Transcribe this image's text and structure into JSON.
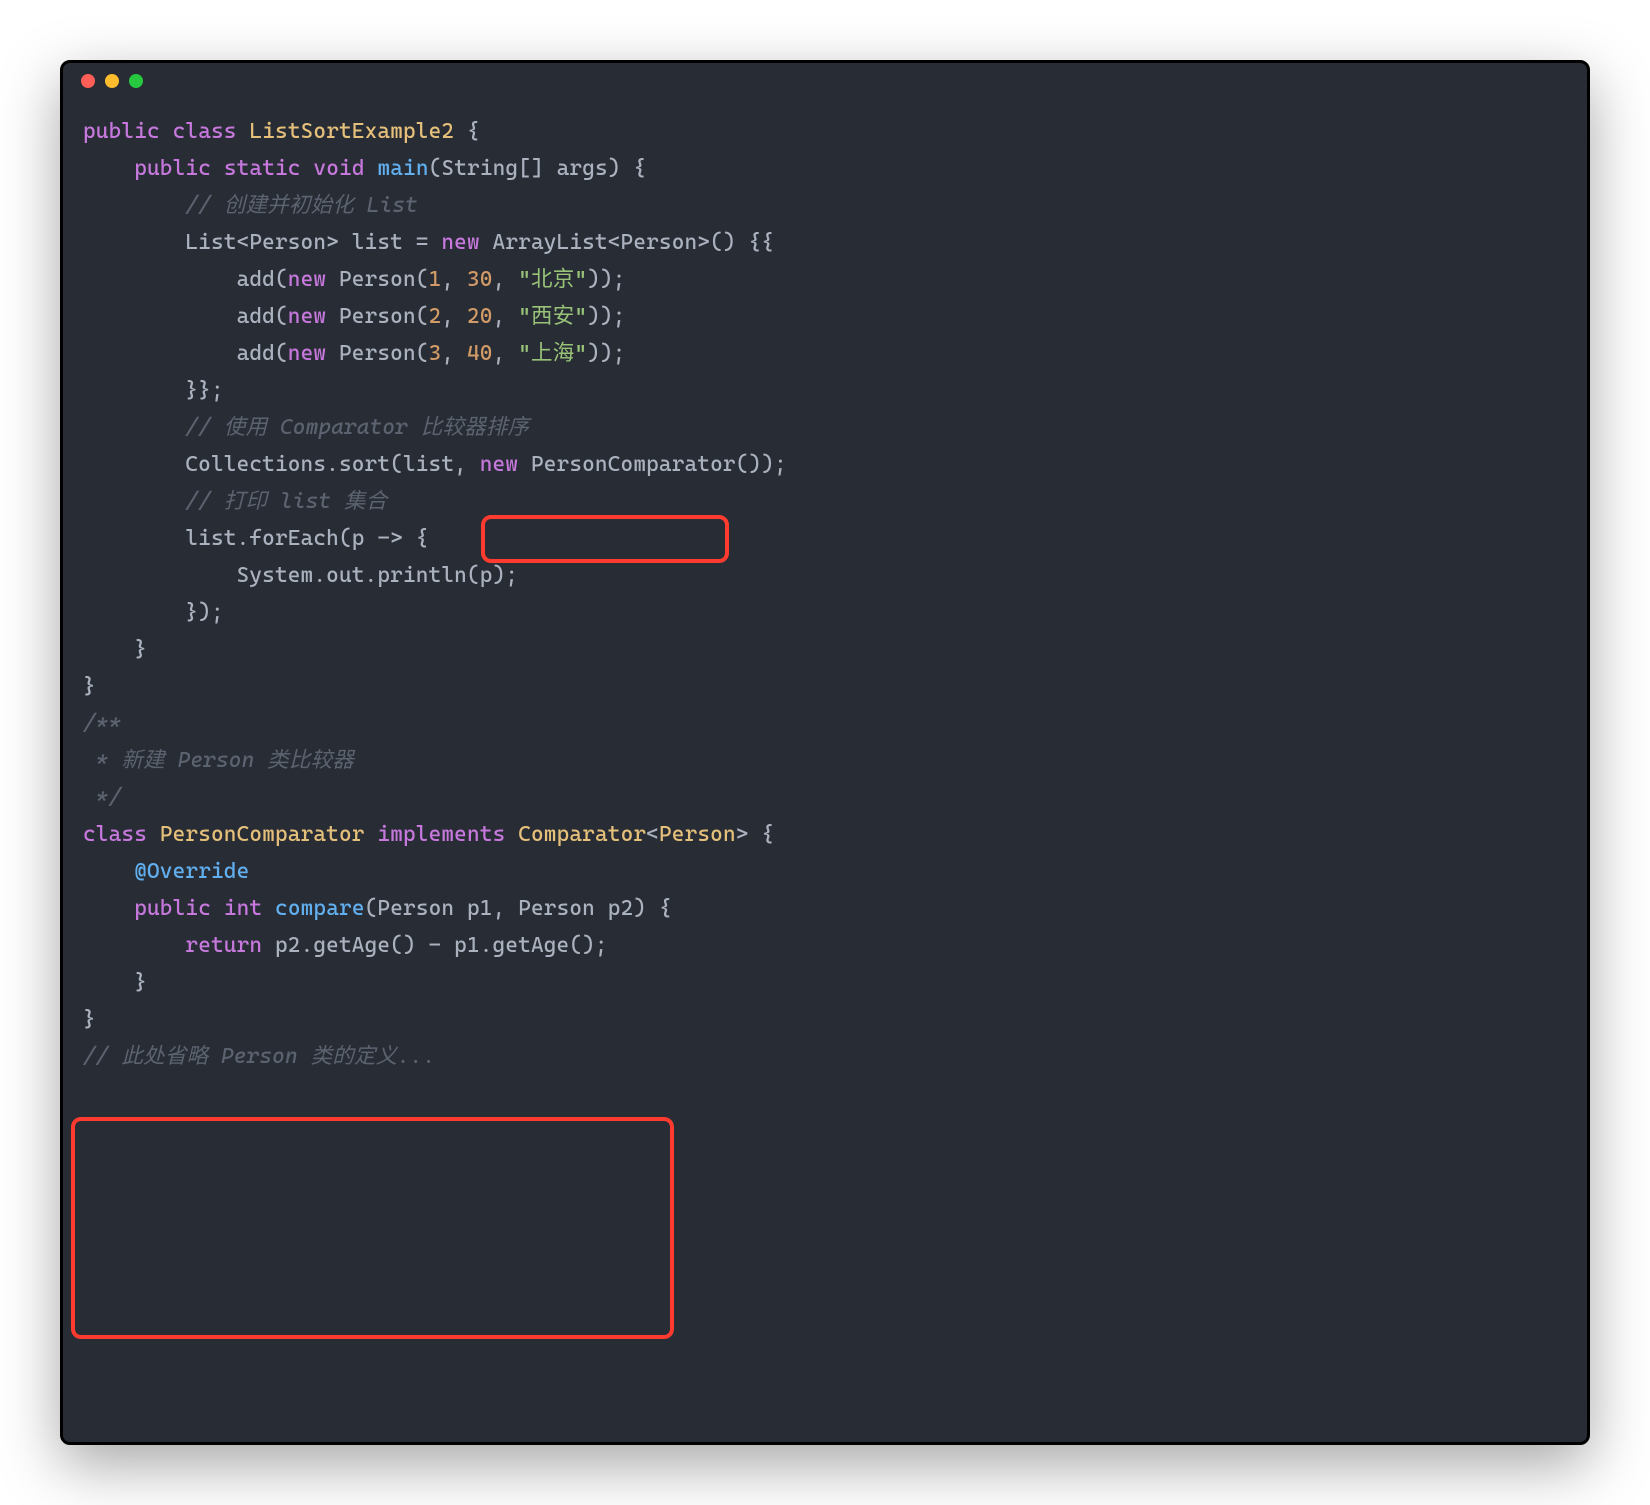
{
  "colors": {
    "bg": "#282c34",
    "fg": "#abb2bf",
    "keyword": "#c678dd",
    "class": "#e5c07b",
    "function": "#61afef",
    "number": "#d19a66",
    "string": "#98c379",
    "comment": "#5c6370",
    "highlight": "#ff3b30"
  },
  "lines": {
    "l1_p1": "public",
    "l1_p2": " ",
    "l1_p3": "class",
    "l1_p4": " ",
    "l1_p5": "ListSortExample2",
    "l1_p6": " {",
    "l2_p1": "    ",
    "l2_p2": "public",
    "l2_p3": " ",
    "l2_p4": "static",
    "l2_p5": " ",
    "l2_p6": "void",
    "l2_p7": " ",
    "l2_p8": "main",
    "l2_p9": "(String[] args) {",
    "l3_p1": "        ",
    "l3_p2": "// 创建并初始化 List",
    "l4_p1": "        List<Person> list = ",
    "l4_p2": "new",
    "l4_p3": " ArrayList<Person>() {{",
    "l5_p1": "            add(",
    "l5_p2": "new",
    "l5_p3": " Person(",
    "l5_p4": "1",
    "l5_p5": ", ",
    "l5_p6": "30",
    "l5_p7": ", ",
    "l5_p8": "\"北京\"",
    "l5_p9": "));",
    "l6_p1": "            add(",
    "l6_p2": "new",
    "l6_p3": " Person(",
    "l6_p4": "2",
    "l6_p5": ", ",
    "l6_p6": "20",
    "l6_p7": ", ",
    "l6_p8": "\"西安\"",
    "l6_p9": "));",
    "l7_p1": "            add(",
    "l7_p2": "new",
    "l7_p3": " Person(",
    "l7_p4": "3",
    "l7_p5": ", ",
    "l7_p6": "40",
    "l7_p7": ", ",
    "l7_p8": "\"上海\"",
    "l7_p9": "));",
    "l8": "        }};",
    "l9_p1": "        ",
    "l9_p2": "// 使用 Comparator 比较器排序",
    "l10_p1": "        Collections.sort(list, ",
    "l10_p2": "new",
    "l10_p3": " PersonComparator());",
    "l11_p1": "        ",
    "l11_p2": "// 打印 list 集合",
    "l12": "        list.forEach(p -> {",
    "l13": "            System.out.println(p);",
    "l14": "        });",
    "l15": "    }",
    "l16": "}",
    "l17_p1": "/**",
    "l18_p1": " * 新建 Person 类比较器",
    "l19_p1": " */",
    "l20_p1": "class",
    "l20_p2": " ",
    "l20_p3": "PersonComparator",
    "l20_p4": " ",
    "l20_p5": "implements",
    "l20_p6": " ",
    "l20_p7": "Comparator",
    "l20_p8": "<",
    "l20_p9": "Person",
    "l20_p10": "> {",
    "l21_p1": "    ",
    "l21_p2": "@Override",
    "l22_p1": "    ",
    "l22_p2": "public",
    "l22_p3": " ",
    "l22_p4": "int",
    "l22_p5": " ",
    "l22_p6": "compare",
    "l22_p7": "(Person p1, Person p2) {",
    "l23_p1": "        ",
    "l23_p2": "return",
    "l23_p3": " p2.getAge() - p1.getAge();",
    "l24": "    }",
    "l25": "}",
    "l26_p1": "// 此处省略 Person 类的定义..."
  }
}
